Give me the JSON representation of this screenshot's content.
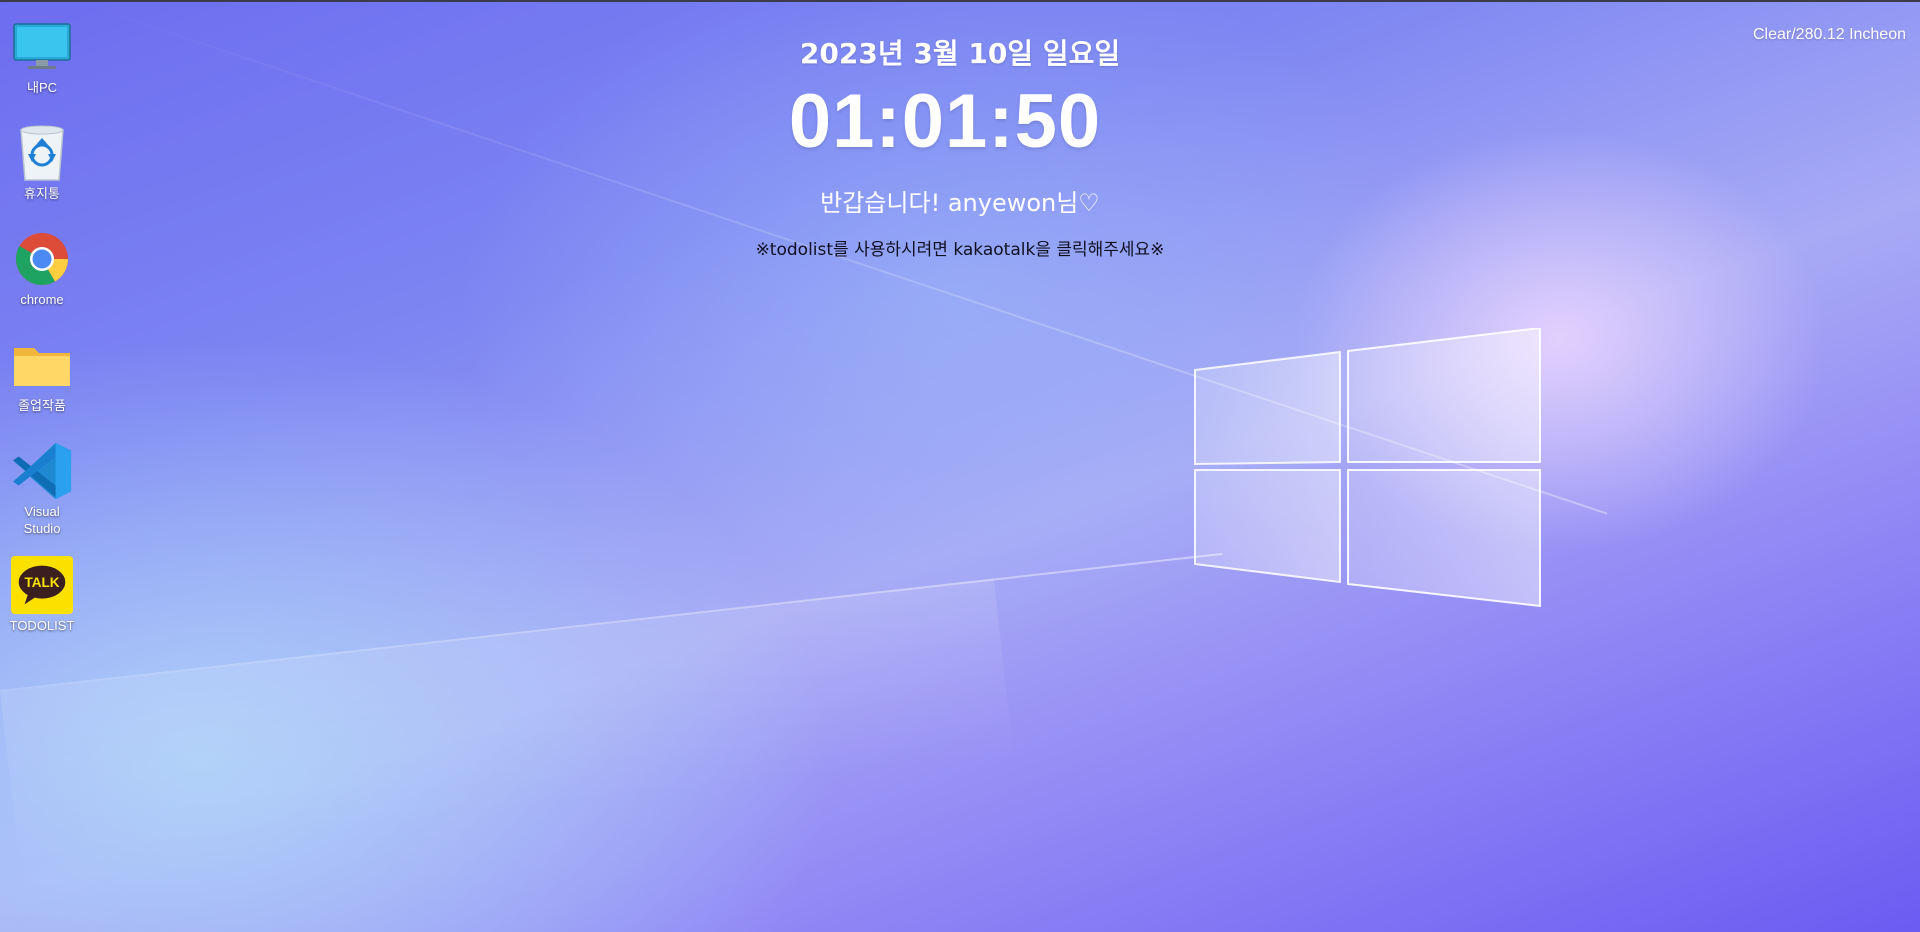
{
  "desktop": {
    "icons": [
      {
        "label": "내PC",
        "icon": "monitor-icon"
      },
      {
        "label": "휴지통",
        "icon": "recycle-bin-icon"
      },
      {
        "label": "chrome",
        "icon": "chrome-icon"
      },
      {
        "label": "졸업작품",
        "icon": "folder-icon"
      },
      {
        "label": "Visual\nStudio",
        "icon": "vscode-icon"
      },
      {
        "label": "TODOLIST",
        "icon": "kakaotalk-icon",
        "badge_text": "TALK"
      }
    ]
  },
  "widget": {
    "date": "2023년 3월 10일 일요일",
    "time": "01:01:50",
    "greeting": "반갑습니다! anyewon님♡",
    "notice": "※todolist를 사용하시려면 kakaotalk을 클릭해주세요※"
  },
  "weather": {
    "text": "Clear/280.12 Incheon"
  },
  "colors": {
    "background_top": "#6d6df0",
    "background_light": "#a8aaf5",
    "kakao_yellow": "#fae100",
    "folder_yellow": "#ffd766"
  }
}
